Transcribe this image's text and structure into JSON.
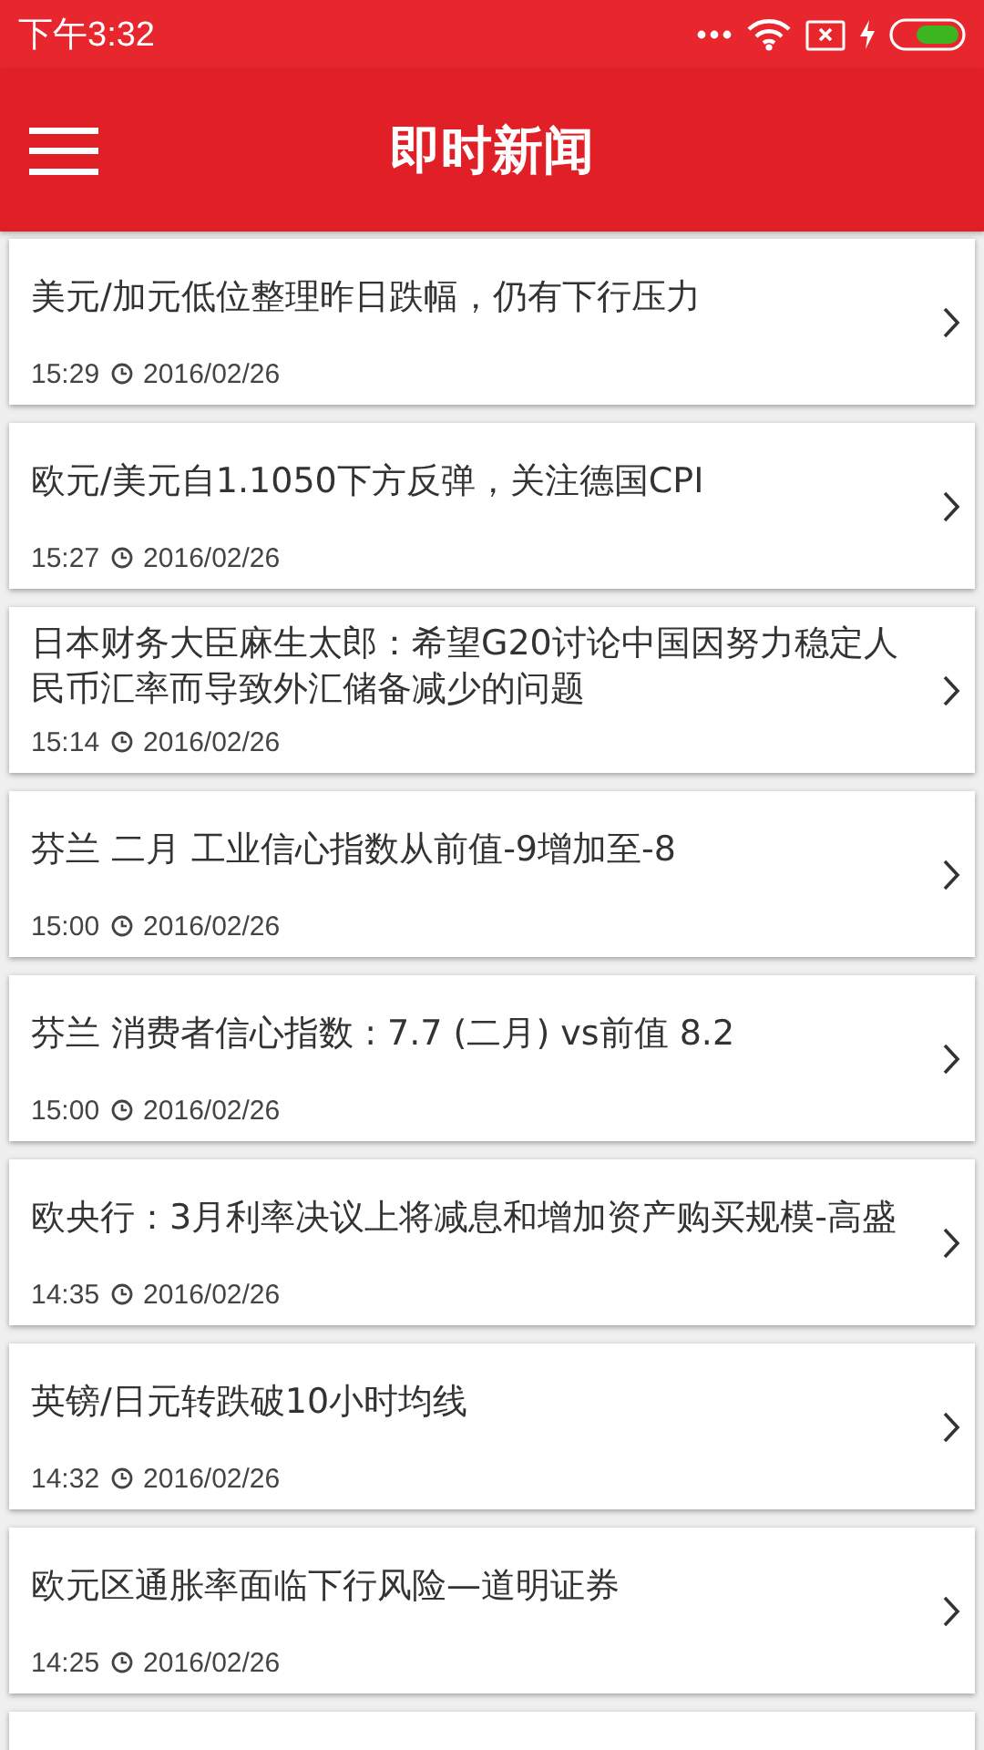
{
  "status_bar": {
    "time": "下午3:32"
  },
  "app_bar": {
    "title": "即时新闻"
  },
  "news": [
    {
      "headline": "美元/加元低位整理昨日跌幅，仍有下行压力",
      "time": "15:29",
      "date": "2016/02/26"
    },
    {
      "headline": "欧元/美元自1.1050下方反弹，关注德国CPI",
      "time": "15:27",
      "date": "2016/02/26"
    },
    {
      "headline": "日本财务大臣麻生太郎：希望G20讨论中国因努力稳定人民币汇率而导致外汇储备减少的问题",
      "time": "15:14",
      "date": "2016/02/26"
    },
    {
      "headline": "芬兰 二月 工业信心指数从前值-9增加至-8",
      "time": "15:00",
      "date": "2016/02/26"
    },
    {
      "headline": "芬兰 消费者信心指数 : 7.7 (二月) vs前值 8.2",
      "time": "15:00",
      "date": "2016/02/26"
    },
    {
      "headline": "欧央行：3月利率决议上将减息和增加资产购买规模-高盛",
      "time": "14:35",
      "date": "2016/02/26"
    },
    {
      "headline": "英镑/日元转跌破10小时均线",
      "time": "14:32",
      "date": "2016/02/26"
    },
    {
      "headline": "欧元区通胀率面临下行风险—道明证券",
      "time": "14:25",
      "date": "2016/02/26"
    }
  ]
}
